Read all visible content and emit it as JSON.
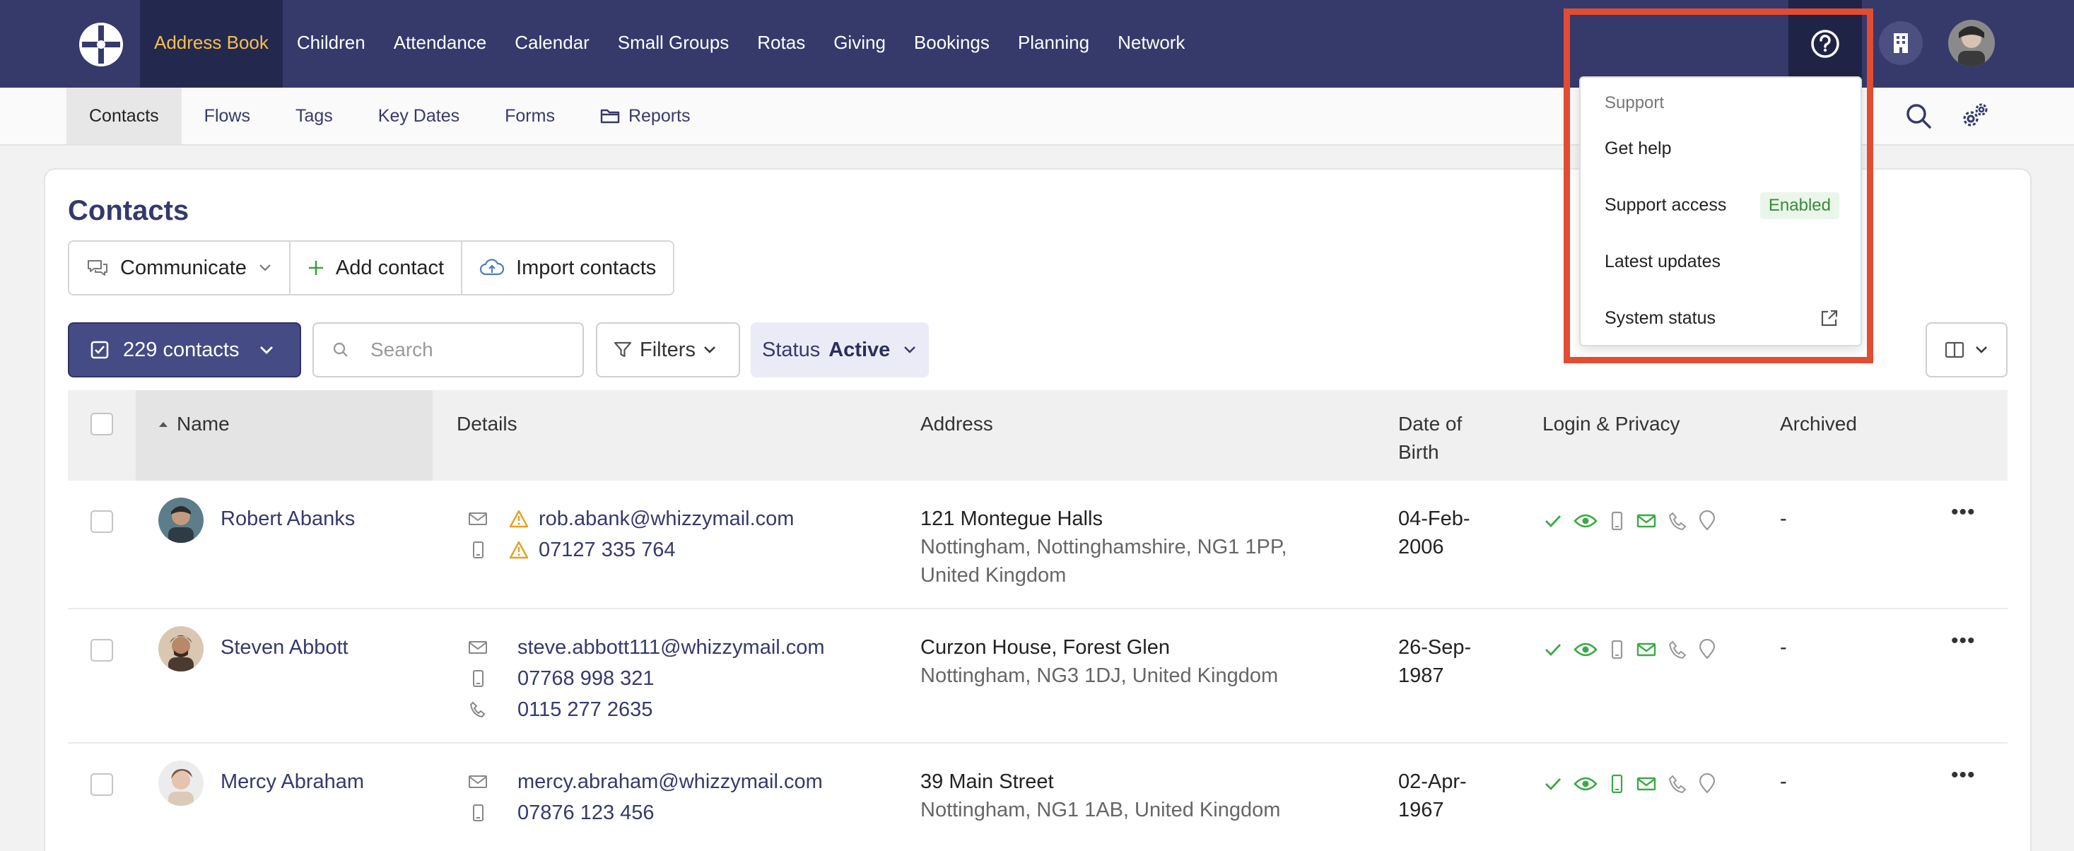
{
  "topnav": {
    "items": [
      "Address Book",
      "Children",
      "Attendance",
      "Calendar",
      "Small Groups",
      "Rotas",
      "Giving",
      "Bookings",
      "Planning",
      "Network"
    ],
    "active": "Address Book",
    "accent": "#f4c04e",
    "background": "#353a6b"
  },
  "subnav": {
    "tabs": [
      "Contacts",
      "Flows",
      "Tags",
      "Key Dates",
      "Forms",
      "Reports"
    ]
  },
  "page": {
    "title": "Contacts",
    "actions": {
      "communicate": "Communicate",
      "add": "Add contact",
      "import": "Import contacts"
    },
    "count_label": "229 contacts",
    "search_placeholder": "Search",
    "filters_label": "Filters",
    "status_label": "Status",
    "status_value": "Active"
  },
  "table": {
    "headers": {
      "name": "Name",
      "details": "Details",
      "address": "Address",
      "dob_line1": "Date of",
      "dob_line2": "Birth",
      "login": "Login & Privacy",
      "archived": "Archived"
    },
    "rows": [
      {
        "name": "Robert Abanks",
        "email": "rob.abank@whizzymail.com",
        "mobile": "07127 335 764",
        "address1": "121 Montegue Halls",
        "address2": "Nottingham, Nottinghamshire, NG1 1PP,",
        "address3": "United Kingdom",
        "dob1": "04-Feb-",
        "dob2": "2006",
        "archived": "-"
      },
      {
        "name": "Steven Abbott",
        "email": "steve.abbott111@whizzymail.com",
        "mobile": "07768 998 321",
        "phone": "0115 277 2635",
        "address1": "Curzon House, Forest Glen",
        "address2": "Nottingham, NG3 1DJ, United Kingdom",
        "dob1": "26-Sep-",
        "dob2": "1987",
        "archived": "-"
      },
      {
        "name": "Mercy Abraham",
        "email": "mercy.abraham@whizzymail.com",
        "mobile": "07876 123 456",
        "address1": "39 Main Street",
        "address2": "Nottingham, NG1 1AB, United Kingdom",
        "dob1": "02-Apr-",
        "dob2": "1967",
        "archived": "-"
      }
    ]
  },
  "support_menu": {
    "header": "Support",
    "items": {
      "get_help": "Get help",
      "support_access": "Support access",
      "support_access_badge": "Enabled",
      "latest_updates": "Latest updates",
      "system_status": "System status"
    }
  }
}
